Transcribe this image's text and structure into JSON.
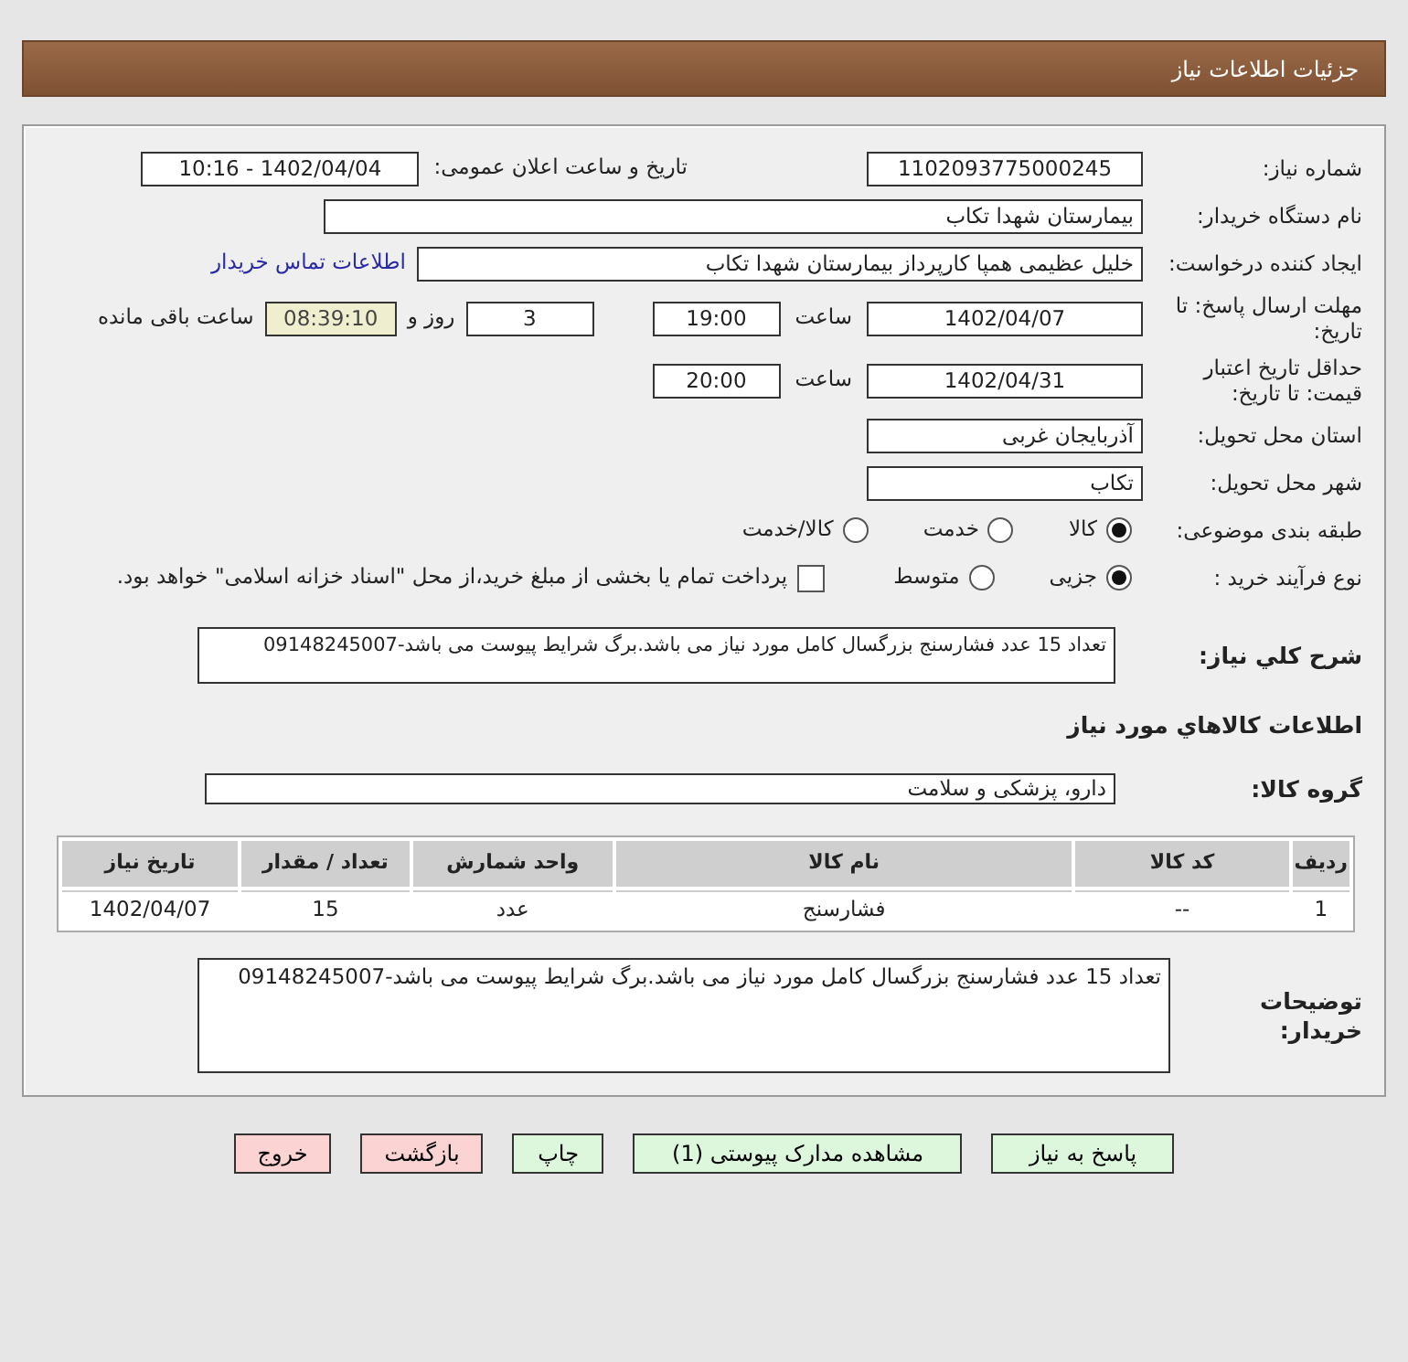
{
  "header": {
    "title": "جزئیات اطلاعات نیاز"
  },
  "need_number": {
    "label": "شماره نیاز:",
    "value": "1102093775000245"
  },
  "announce": {
    "label": "تاریخ و ساعت اعلان عمومی:",
    "value": "1402/04/04 - 10:16"
  },
  "buyer_org": {
    "label": "نام دستگاه خریدار:",
    "value": "بیمارستان شهدا تکاب"
  },
  "requester": {
    "label": "ایجاد کننده درخواست:",
    "value": "خلیل عظیمی همپا کارپرداز بیمارستان شهدا تکاب",
    "link": "اطلاعات تماس خریدار"
  },
  "deadline": {
    "label": "مهلت ارسال پاسخ: تا تاریخ:",
    "date": "1402/04/07",
    "time_label": "ساعت",
    "time": "19:00",
    "days": "3",
    "days_label": "روز و",
    "remaining": "08:39:10",
    "remaining_label": "ساعت باقی مانده"
  },
  "validity": {
    "label": "حداقل تاریخ اعتبار قیمت: تا تاریخ:",
    "date": "1402/04/31",
    "time_label": "ساعت",
    "time": "20:00"
  },
  "province": {
    "label": "استان محل تحویل:",
    "value": "آذربایجان غربی"
  },
  "city": {
    "label": "شهر محل تحویل:",
    "value": "تکاب"
  },
  "category": {
    "label": "طبقه بندی موضوعی:",
    "options": [
      {
        "label": "کالا",
        "selected": true
      },
      {
        "label": "خدمت",
        "selected": false
      },
      {
        "label": "کالا/خدمت",
        "selected": false
      }
    ]
  },
  "process": {
    "label": "نوع فرآیند خرید :",
    "options": [
      {
        "label": "جزیی",
        "selected": true
      },
      {
        "label": "متوسط",
        "selected": false
      }
    ],
    "payment": {
      "label": "پرداخت تمام یا بخشی از مبلغ خرید،از محل \"اسناد خزانه اسلامی\" خواهد بود.",
      "checked": false
    }
  },
  "summary": {
    "label": "شرح کلي نياز:",
    "value": "تعداد 15 عدد فشارسنج بزرگسال کامل مورد نیاز می باشد.برگ شرایط پیوست می باشد-09148245007"
  },
  "goods_heading": "اطلاعات کالاهاي مورد نياز",
  "goods_group": {
    "label": "گروه کالا:",
    "value": "دارو، پزشکی و سلامت"
  },
  "table": {
    "columns": [
      "ردیف",
      "کد کالا",
      "نام کالا",
      "واحد شمارش",
      "تعداد / مقدار",
      "تاریخ نیاز"
    ],
    "rows": [
      [
        "1",
        "--",
        "فشارسنج",
        "عدد",
        "15",
        "1402/04/07"
      ]
    ]
  },
  "buyer_notes": {
    "label": "توضیحات خریدار:",
    "value": "تعداد 15 عدد فشارسنج بزرگسال کامل مورد نیاز می باشد.برگ شرایط پیوست می باشد-09148245007"
  },
  "buttons": [
    {
      "label": "پاسخ به نیاز",
      "kind": "action"
    },
    {
      "label": "مشاهده مدارک پیوستی (1)",
      "kind": "action"
    },
    {
      "label": "چاپ",
      "kind": "action"
    },
    {
      "label": "بازگشت",
      "kind": "exit"
    },
    {
      "label": "خروج",
      "kind": "exit"
    }
  ]
}
